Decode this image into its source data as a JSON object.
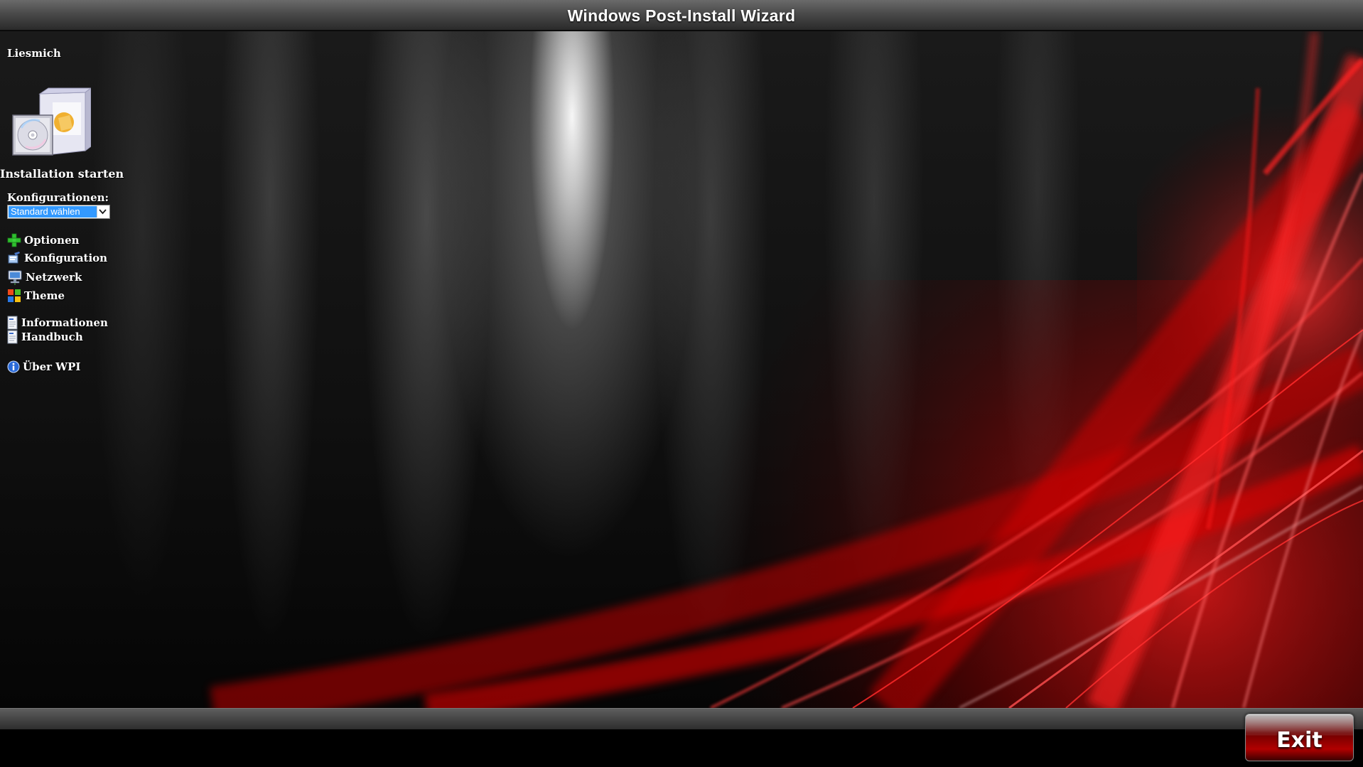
{
  "window": {
    "title": "Windows Post-Install Wizard"
  },
  "sidebar": {
    "readme_label": "Liesmich",
    "install": {
      "label": "Installation starten",
      "icon": "software-box-cd-icon"
    },
    "configurations": {
      "label": "Konfigurationen:",
      "selected": "Standard wählen"
    },
    "menu": [
      {
        "label": "Optionen",
        "icon": "green-plus-icon"
      },
      {
        "label": "Konfiguration",
        "icon": "config-pen-icon"
      },
      {
        "label": "Netzwerk",
        "icon": "network-computer-icon"
      },
      {
        "label": "Theme",
        "icon": "windows-flag-icon"
      }
    ],
    "documents": [
      {
        "label": "Informationen",
        "icon": "document-icon"
      },
      {
        "label": "Handbuch",
        "icon": "document-icon"
      }
    ],
    "about": {
      "label": "Über WPI",
      "icon": "info-icon"
    }
  },
  "footer": {
    "exit_label": "Exit"
  },
  "colors": {
    "accent_red": "#e00000",
    "selection_blue": "#3399ff",
    "bar_gray": "#4a4a4a"
  }
}
